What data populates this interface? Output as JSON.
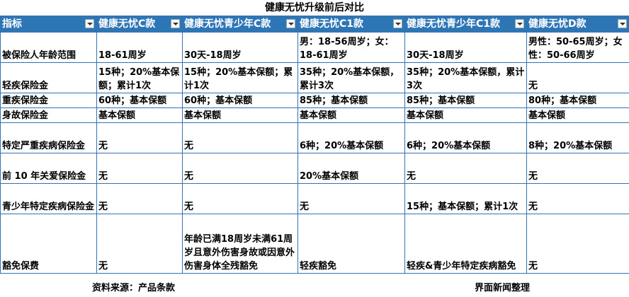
{
  "title": "健康无忧升级前后对比",
  "headers": [
    "指标",
    "健康无忧C款",
    "健康无忧青少年C款",
    "健康无忧C1款",
    "健康无忧青少年C1款",
    "健康无忧D款"
  ],
  "rows": [
    [
      "被保险人年龄范围",
      "18-61周岁",
      "30天-18周岁",
      "男：18-56周岁；女：18-61周岁",
      "30天-18周岁",
      "男性：50-65周岁；女性：50-66周岁"
    ],
    [
      "轻疾保险金",
      "15种；20%基本保额；累计1次",
      "15种；20%基本保额；累计1次",
      "35种；20%基本保额，累计3次",
      "35种；20%基本保额，累计3次",
      "无"
    ],
    [
      "重疾保险金",
      "60种；基本保额",
      "60种；基本保额",
      "85种；基本保额",
      "85种；基本保额",
      "80种；基本保额"
    ],
    [
      "身故保险金",
      "基本保额",
      "基本保额",
      "基本保额",
      "基本保额",
      "基本保额"
    ],
    [
      "特定严重疾病保险金",
      "无",
      "无",
      "6种；20%基本保额",
      "6种；20%基本保额",
      "8种；20%基本保额"
    ],
    [
      "前 10 年关爱保险金",
      "无",
      "无",
      "20%基本保额",
      "无",
      "无"
    ],
    [
      "青少年特定疾病保险金",
      "无",
      "无",
      "无",
      "15种；基本保额；累计1次",
      "无"
    ],
    [
      "豁免保费",
      "无",
      "年龄已满18周岁未满61周岁且意外伤害身故或因意外伤害身体全残豁免",
      "轻疾豁免",
      "轻疾&青少年特定疾病豁免",
      "无"
    ]
  ],
  "footer": {
    "source": "资料来源：产品条款",
    "editor": "界面新闻整理"
  },
  "colors": {
    "header_bg": "#2e75b6",
    "border": "#2f75b6"
  }
}
